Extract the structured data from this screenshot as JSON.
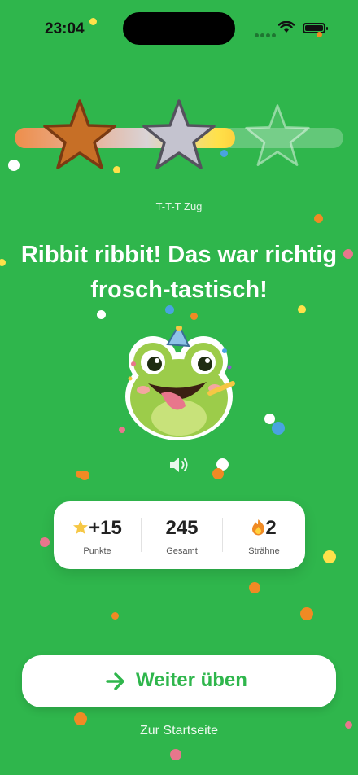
{
  "status_bar": {
    "time": "23:04"
  },
  "progress": {
    "fraction": 0.67,
    "stars": [
      "bronze",
      "silver",
      "gold"
    ]
  },
  "subtitle": "T-T-T Zug",
  "headline": "Ribbit ribbit! Das war richtig frosch-tastisch!",
  "mascot": {
    "icon": "party-frog-icon"
  },
  "sound_icon": "speaker-icon",
  "stats": {
    "points": {
      "icon": "star-icon",
      "value": "+15",
      "label": "Punkte"
    },
    "total": {
      "value": "245",
      "label": "Gesamt"
    },
    "streak": {
      "icon": "flame-icon",
      "value": "2",
      "label": "Strähne"
    }
  },
  "cta": {
    "label": "Weiter üben",
    "icon": "arrow-right-icon"
  },
  "secondary_link": "Zur Startseite",
  "colors": {
    "background": "#2fb64c",
    "accent": "#2fb64c",
    "bronze": "#c76f26",
    "silver": "#b9b9c6",
    "gold": "#ffd23e"
  }
}
